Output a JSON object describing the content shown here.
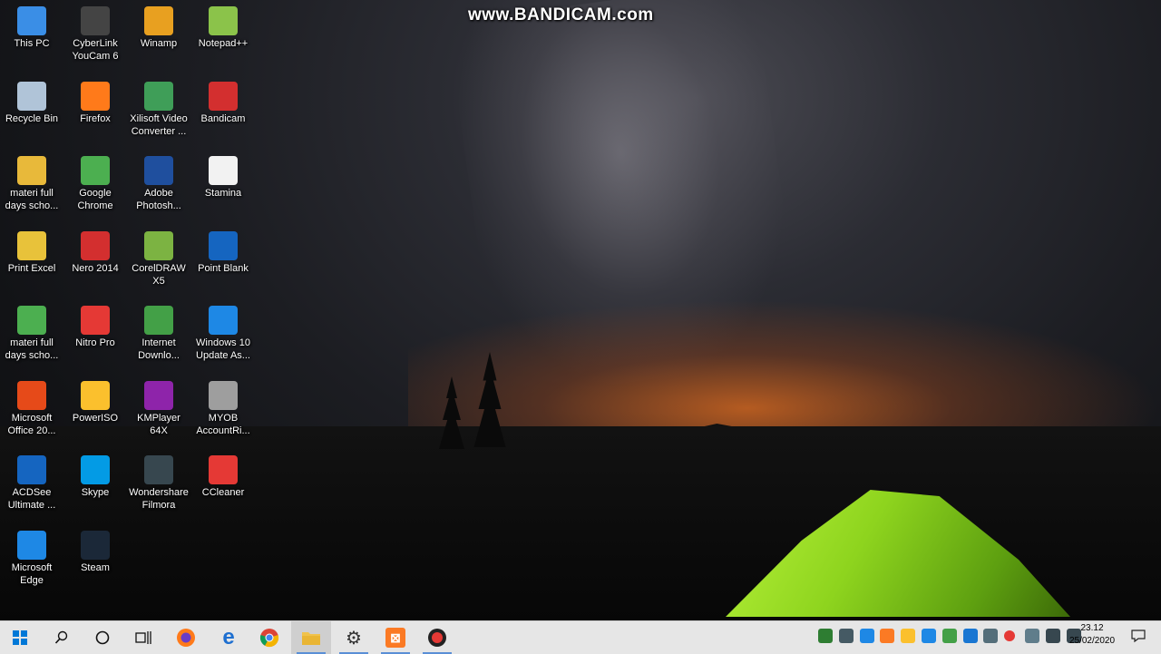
{
  "watermark": "www.BANDICAM.com",
  "desktop": {
    "icons": [
      {
        "label": "This PC",
        "icon": "computer-icon",
        "color": "#3a8ee6"
      },
      {
        "label": "CyberLink YouCam 6",
        "icon": "webcam-icon",
        "color": "#444444"
      },
      {
        "label": "Winamp",
        "icon": "winamp-icon",
        "color": "#e8a020"
      },
      {
        "label": "Notepad++",
        "icon": "notepad-icon",
        "color": "#8bc34a"
      },
      {
        "label": "Recycle Bin",
        "icon": "recycle-bin-icon",
        "color": "#b0c4d8"
      },
      {
        "label": "Firefox",
        "icon": "firefox-icon",
        "color": "#ff7a1a"
      },
      {
        "label": "Xilisoft Video Converter ...",
        "icon": "video-converter-icon",
        "color": "#3f9e58"
      },
      {
        "label": "Bandicam",
        "icon": "bandicam-icon",
        "color": "#d32f2f"
      },
      {
        "label": "materi full days scho...",
        "icon": "folder-icon",
        "color": "#e8b93a"
      },
      {
        "label": "Google Chrome",
        "icon": "chrome-icon",
        "color": "#4caf50"
      },
      {
        "label": "Adobe Photosh...",
        "icon": "photoshop-icon",
        "color": "#1f4f9e"
      },
      {
        "label": "Stamina",
        "icon": "stamina-icon",
        "color": "#f2f2f2"
      },
      {
        "label": "Print Excel",
        "icon": "folder-icon",
        "color": "#e8c23a"
      },
      {
        "label": "Nero 2014",
        "icon": "nero-icon",
        "color": "#d32f2f"
      },
      {
        "label": "CorelDRAW X5",
        "icon": "coreldraw-icon",
        "color": "#7cb342"
      },
      {
        "label": "Point Blank",
        "icon": "point-blank-icon",
        "color": "#1565c0"
      },
      {
        "label": "materi full days scho...",
        "icon": "chrome-icon",
        "color": "#4caf50"
      },
      {
        "label": "Nitro Pro",
        "icon": "nitro-icon",
        "color": "#e53935"
      },
      {
        "label": "Internet Downlo...",
        "icon": "download-manager-icon",
        "color": "#43a047"
      },
      {
        "label": "Windows 10 Update As...",
        "icon": "windows-icon",
        "color": "#1e88e5"
      },
      {
        "label": "Microsoft Office 20...",
        "icon": "office-icon",
        "color": "#e64a19"
      },
      {
        "label": "PowerISO",
        "icon": "poweriso-icon",
        "color": "#fbc02d"
      },
      {
        "label": "KMPlayer 64X",
        "icon": "kmplayer-icon",
        "color": "#8e24aa"
      },
      {
        "label": "MYOB AccountRi...",
        "icon": "myob-icon",
        "color": "#9e9e9e"
      },
      {
        "label": "ACDSee Ultimate ...",
        "icon": "acdsee-icon",
        "color": "#1565c0"
      },
      {
        "label": "Skype",
        "icon": "skype-icon",
        "color": "#039be5"
      },
      {
        "label": "Wondershare Filmora",
        "icon": "filmora-icon",
        "color": "#37474f"
      },
      {
        "label": "CCleaner",
        "icon": "ccleaner-icon",
        "color": "#e53935"
      },
      {
        "label": "Microsoft Edge",
        "icon": "edge-icon",
        "color": "#1e88e5"
      },
      {
        "label": "Steam",
        "icon": "steam-icon",
        "color": "#1b2838"
      }
    ]
  },
  "taskbar": {
    "buttons": [
      {
        "name": "start-button",
        "icon": "windows-logo-icon"
      },
      {
        "name": "search-button",
        "icon": "search-icon"
      },
      {
        "name": "cortana-button",
        "icon": "circle-icon"
      },
      {
        "name": "task-view-button",
        "icon": "task-view-icon"
      },
      {
        "name": "firefox-taskbar-button",
        "icon": "firefox-icon"
      },
      {
        "name": "edge-taskbar-button",
        "icon": "edge-icon"
      },
      {
        "name": "chrome-taskbar-button",
        "icon": "chrome-icon"
      },
      {
        "name": "file-explorer-taskbar-button",
        "icon": "folder-icon"
      },
      {
        "name": "settings-taskbar-button",
        "icon": "gear-icon"
      },
      {
        "name": "xampp-taskbar-button",
        "icon": "xampp-icon"
      },
      {
        "name": "bandicam-taskbar-button",
        "icon": "record-icon"
      }
    ],
    "tray": [
      "shield-icon",
      "network-globe-icon",
      "storage-icon",
      "xampp-tray-icon",
      "smiley-icon",
      "monitor-icon",
      "green-app-icon",
      "bluetooth-icon",
      "sync-icon",
      "record-tray-icon",
      "usb-icon",
      "battery-icon",
      "volume-icon"
    ],
    "clock": {
      "time": "23.12",
      "date": "25/02/2020"
    },
    "notification": "notification-icon"
  }
}
